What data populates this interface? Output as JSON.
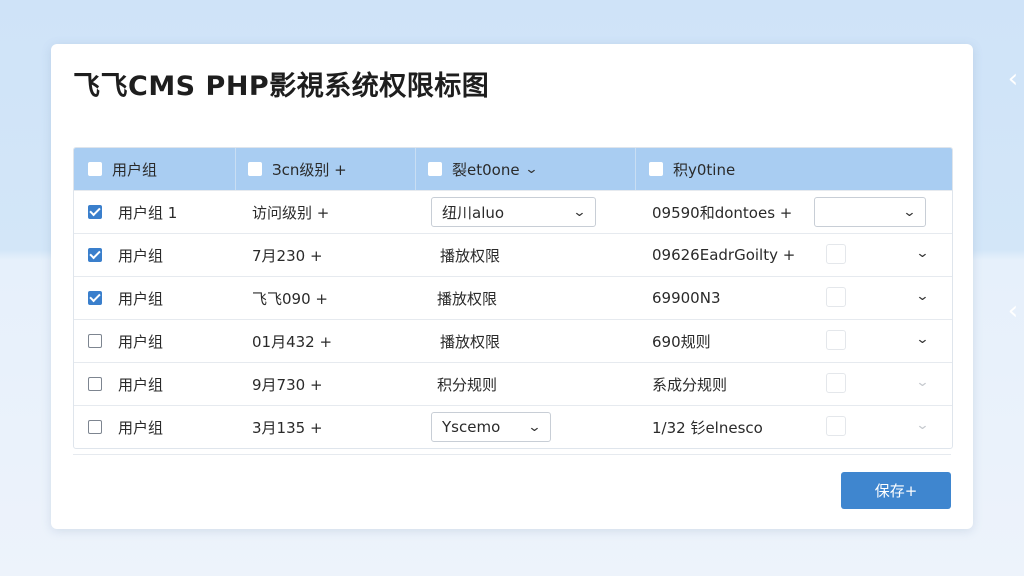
{
  "page": {
    "title": "飞飞CMS PHP影視系统权限标图",
    "save_label": "保存+"
  },
  "table": {
    "headers": [
      "用户组",
      "Зcn级别 +",
      "裂et0one",
      "积y0tine"
    ],
    "rows": [
      {
        "checked": true,
        "group": "用户组 1",
        "col2": "访问级别 +",
        "col3": "纽川aluo",
        "col4": "09590和dontoes +",
        "has_select3": true,
        "has_select4": true
      },
      {
        "checked": true,
        "group": "用户组",
        "col2": "7月230 +",
        "col3": "播放权限",
        "col4": "09626EadrGoilty +",
        "has_select3": false,
        "has_select4": false
      },
      {
        "checked": true,
        "group": "用户组",
        "col2": "飞飞090 +",
        "col3": "播放权限",
        "col4": "69900N3",
        "has_select3": false,
        "has_select4": false
      },
      {
        "checked": false,
        "group": "用户组",
        "col2": "01月432 +",
        "col3": "播放权限",
        "col4": "690规则",
        "has_select3": false,
        "has_select4": false
      },
      {
        "checked": false,
        "group": "用户组",
        "col2": "9月730 +",
        "col3": "积分规则",
        "col4": "系成分规则",
        "has_select3": false,
        "has_select4": false
      },
      {
        "checked": false,
        "group": "用户组",
        "col2": "3月135 +",
        "col3": "Yscemo",
        "col4": "1/32 钐elnesco",
        "has_select3": true,
        "has_select4": false
      }
    ]
  },
  "colors": {
    "header_bg": "#a9cdf2",
    "accent": "#3f86cf",
    "checkbox_checked": "#3a7fcc"
  },
  "icons": {
    "dropdown": "chevron-down-icon",
    "edge_nav": "chevron-left-icon"
  }
}
